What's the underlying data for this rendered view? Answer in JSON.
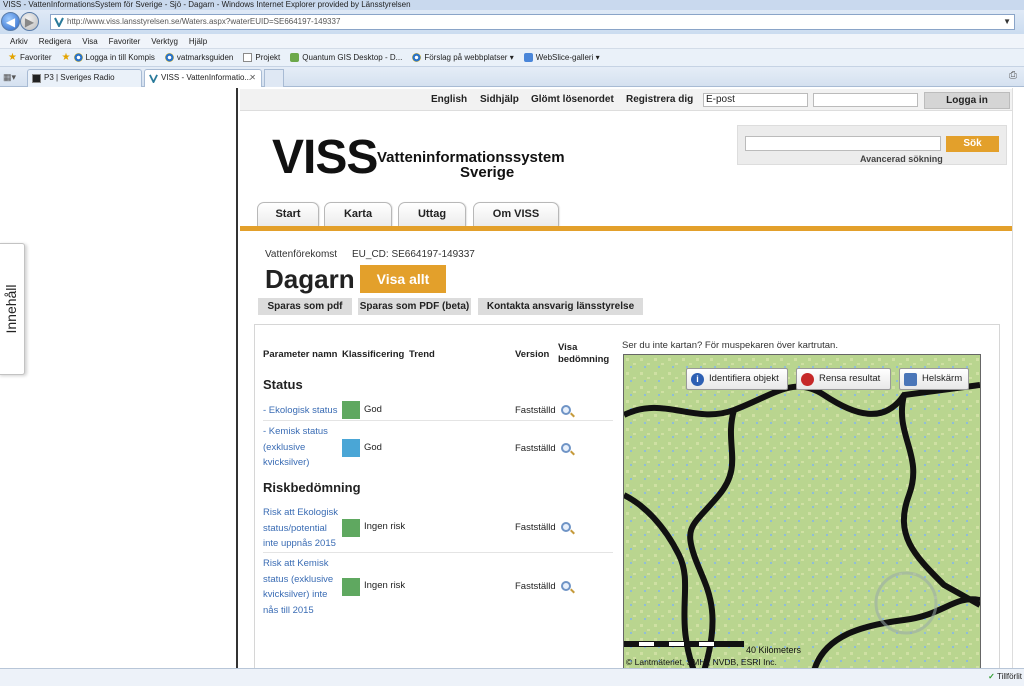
{
  "browser": {
    "title": "VISS - VattenInformationsSystem för Sverige - Sjö - Dagarn - Windows Internet Explorer provided by Länsstyrelsen",
    "address": "http://www.viss.lansstyrelsen.se/Waters.aspx?waterEUID=SE664197-149337",
    "menu": [
      "Arkiv",
      "Redigera",
      "Visa",
      "Favoriter",
      "Verktyg",
      "Hjälp"
    ],
    "favorites_label": "Favoriter",
    "favorites": [
      "Logga in till Kompis",
      "vatmarksguiden",
      "Projekt",
      "Quantum GIS Desktop - D...",
      "Förslag på webbplatser ▾",
      "WebSlice-galleri ▾"
    ],
    "tabs": [
      "P3 | Sveriges Radio",
      "VISS - VattenInformatio..."
    ],
    "status_text": "Tillförlit"
  },
  "sidebar": {
    "label": "Innehåll"
  },
  "topbar": {
    "links": [
      "English",
      "Sidhjälp",
      "Glömt lösenordet",
      "Registrera dig"
    ],
    "email_value": "E-post",
    "password_value": "",
    "login_label": "Logga in"
  },
  "logo": {
    "big": "VISS",
    "line1": "Vatteninformationssystem",
    "line2": "Sverige"
  },
  "search": {
    "button_label": "Sök",
    "advanced_label": "Avancerad sökning",
    "value": ""
  },
  "nav": [
    "Start",
    "Karta",
    "Uttag",
    "Om VISS"
  ],
  "water": {
    "type": "Vattenförekomst",
    "eu_cd": "EU_CD: SE664197-149337",
    "name": "Dagarn",
    "show_all": "Visa allt"
  },
  "actions": [
    "Sparas som pdf",
    "Sparas som PDF (beta)",
    "Kontakta ansvarig länsstyrelse"
  ],
  "table": {
    "headers": {
      "parameter": "Parameter namn",
      "classification": "Klassificering",
      "trend": "Trend",
      "version": "Version",
      "show": "Visa bedömning"
    },
    "sections": [
      {
        "title": "Status",
        "rows": [
          {
            "param": "- Ekologisk status",
            "color": "#5fa860",
            "class": "God",
            "version": "Fastställd"
          },
          {
            "param": "- Kemisk status (exklusive kvicksilver)",
            "color": "#4aa6d6",
            "class": "God",
            "version": "Fastställd"
          }
        ]
      },
      {
        "title": "Riskbedömning",
        "rows": [
          {
            "param": "Risk att Ekologisk status/potential inte uppnås 2015",
            "color": "#5fa860",
            "class": "Ingen risk",
            "version": "Fastställd"
          },
          {
            "param": "Risk att Kemisk status (exklusive kvicksilver) inte nås till 2015",
            "color": "#5fa860",
            "class": "Ingen risk",
            "version": "Fastställd"
          }
        ]
      }
    ]
  },
  "map": {
    "hint": "Ser du inte kartan? För muspekaren över kartrutan.",
    "buttons": [
      "Identifiera objekt",
      "Rensa resultat",
      "Helskärm"
    ],
    "scale_label": "40 Kilometers",
    "copyright": "© Lantmäteriet, SMHI, NVDB, ESRI Inc.",
    "colors": {
      "land": "#b9d58f",
      "land_alt": "#cfe0a3",
      "water": "#8fbcd8",
      "border": "#111111"
    }
  },
  "colors": {
    "accent": "#e3a02b",
    "link": "#3a6cb4"
  }
}
